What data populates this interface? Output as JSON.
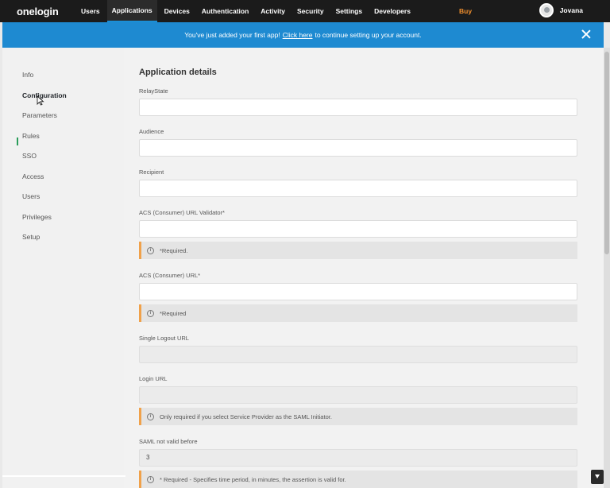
{
  "nav": {
    "logo": "onelogin",
    "items": [
      "Users",
      "Applications",
      "Devices",
      "Authentication",
      "Activity",
      "Security",
      "Settings",
      "Developers"
    ],
    "active_index": 1,
    "buy": "Buy",
    "user_name": "Jovana"
  },
  "banner": {
    "text_before": "You've just added your first app!",
    "link": "Click here",
    "text_after": "to continue setting up your account."
  },
  "sidebar": {
    "items": [
      "Info",
      "Configuration",
      "Parameters",
      "Rules",
      "SSO",
      "Access",
      "Users",
      "Privileges",
      "Setup"
    ],
    "active_index": 1
  },
  "main": {
    "title": "Application details",
    "fields": [
      {
        "label": "RelayState",
        "value": ""
      },
      {
        "label": "Audience",
        "value": ""
      },
      {
        "label": "Recipient",
        "value": ""
      },
      {
        "label": "ACS (Consumer) URL Validator*",
        "value": "",
        "note": "*Required."
      },
      {
        "label": "ACS (Consumer) URL*",
        "value": "",
        "note": "*Required"
      },
      {
        "label": "Single Logout URL",
        "value": ""
      },
      {
        "label": "Login URL",
        "value": "",
        "note": "Only required if you select Service Provider as the SAML Initiator."
      },
      {
        "label": "SAML not valid before",
        "value": "3",
        "note": "* Required - Specifies time period, in minutes, the assertion is valid for."
      }
    ]
  },
  "icons": {
    "close": "close-icon",
    "info": "info-icon",
    "avatar": "user-avatar",
    "cursor": "mouse-pointer-icon"
  }
}
